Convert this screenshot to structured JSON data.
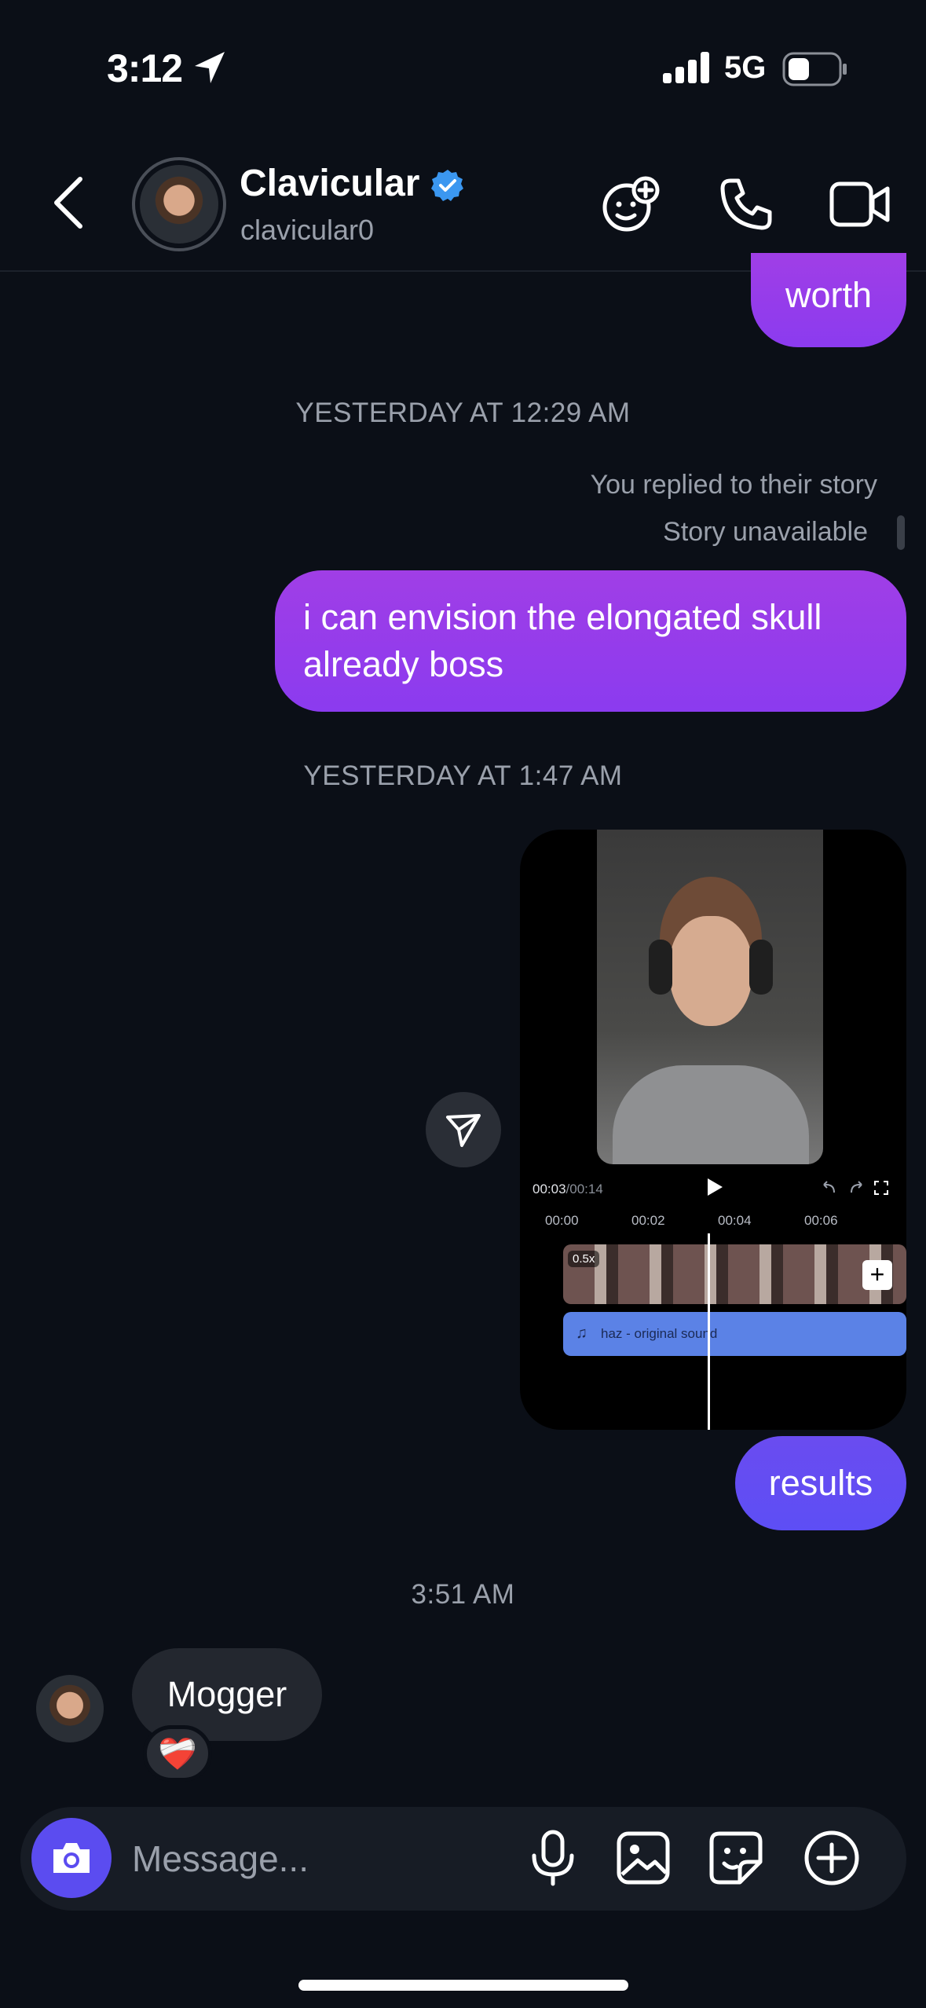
{
  "status_bar": {
    "time": "3:12",
    "network": "5G"
  },
  "header": {
    "contact_name": "Clavicular",
    "contact_handle": "clavicular0",
    "verified": true,
    "back_icon": "chevron-left-icon",
    "actions": [
      "add-effect-icon",
      "phone-icon",
      "video-camera-icon"
    ]
  },
  "messages": {
    "worth_text": "worth",
    "timestamp_1": "YESTERDAY AT 12:29 AM",
    "story_reply_note": "You replied to their story",
    "story_status": "Story unavailable",
    "reply_text": "i can envision the elongated skull already boss",
    "timestamp_2": "YESTERDAY AT 1:47 AM",
    "results_text": "results",
    "timestamp_3": "3:51 AM",
    "incoming_text": "Mogger",
    "reaction": "❤️‍🩹"
  },
  "video": {
    "time_readout_current": "00:03",
    "time_readout_total": "/00:14",
    "ticks": [
      "00:00",
      "00:02",
      "00:04",
      "00:06"
    ],
    "speed_badge": "0.5x",
    "audio_label": "haz - original sound",
    "playhead_fraction": 0.214
  },
  "composer": {
    "placeholder": "Message...",
    "icons": [
      "microphone-icon",
      "gallery-icon",
      "sticker-icon",
      "plus-circle-icon"
    ]
  },
  "colors": {
    "background": "#0b0f17",
    "purple_bubble": "#9a3de9",
    "blue_bubble": "#6450f2",
    "incoming_bubble": "#23272f",
    "camera_button": "#5b4cf0",
    "verified_badge": "#3b97f0"
  }
}
